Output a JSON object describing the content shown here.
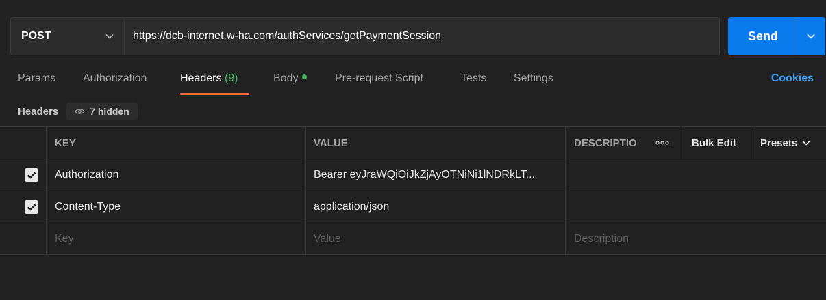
{
  "request": {
    "method": "POST",
    "url": "https://dcb-internet.w-ha.com/authServices/getPaymentSession",
    "send_label": "Send"
  },
  "tabs": [
    {
      "label": "Params"
    },
    {
      "label": "Authorization"
    },
    {
      "label": "Headers",
      "count": "(9)"
    },
    {
      "label": "Body"
    },
    {
      "label": "Pre-request Script"
    },
    {
      "label": "Tests"
    },
    {
      "label": "Settings"
    }
  ],
  "cookies_label": "Cookies",
  "headers_section": {
    "title": "Headers",
    "hidden_label": "7 hidden"
  },
  "table": {
    "columns": {
      "key": "KEY",
      "value": "VALUE",
      "description": "DESCRIPTIO",
      "bulk_edit": "Bulk Edit",
      "presets": "Presets"
    },
    "rows": [
      {
        "checked": true,
        "key": "Authorization",
        "value": "Bearer eyJraWQiOiJkZjAyOTNiNi1lNDRkLT..."
      },
      {
        "checked": true,
        "key": "Content-Type",
        "value": "application/json"
      }
    ],
    "placeholders": {
      "key": "Key",
      "value": "Value",
      "description": "Description"
    }
  },
  "colors": {
    "background": "#212121",
    "send_button": "#097bed",
    "active_tab_underline": "#f26b3a",
    "count_green": "#3fbc5c",
    "cookies_link": "#3d9bf5"
  },
  "icons": {
    "method_dropdown": "chevron-down-icon",
    "send_dropdown": "chevron-down-icon",
    "hidden_toggle": "eye-icon",
    "more_options": "more-dots-icon",
    "presets_dropdown": "chevron-down-icon",
    "row_checkbox": "checkmark-icon"
  }
}
